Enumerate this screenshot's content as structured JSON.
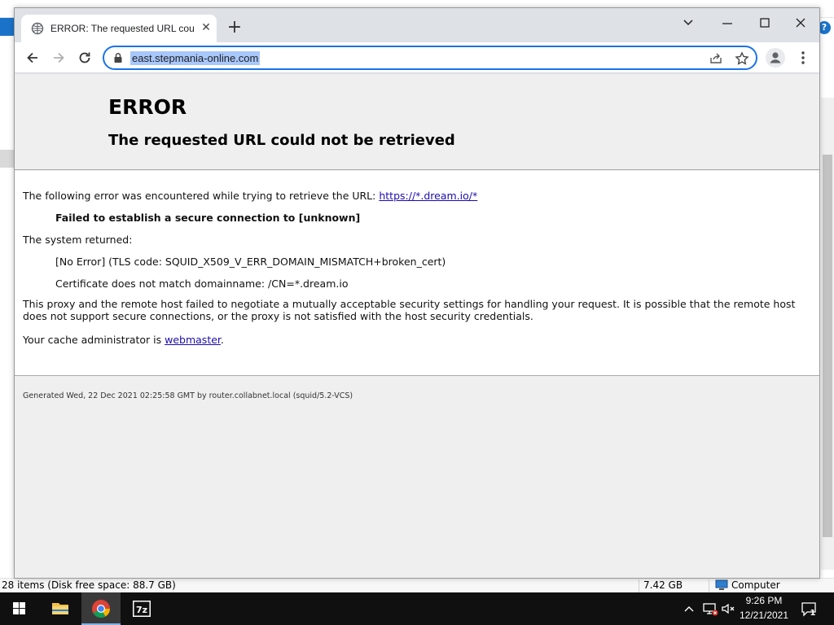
{
  "background_window": {
    "status_items": "28 items (Disk free space: 88.7 GB)",
    "status_size": "7.42 GB",
    "status_location": "Computer",
    "help_glyph": "?"
  },
  "browser": {
    "tab": {
      "title": "ERROR: The requested URL could not be retrieved",
      "close_glyph": "✕"
    },
    "new_tab_glyph": "+",
    "address": {
      "url": "east.stepmania-online.com"
    }
  },
  "page": {
    "title": "ERROR",
    "subtitle": "The requested URL could not be retrieved",
    "intro_text": "The following error was encountered while trying to retrieve the URL: ",
    "intro_link": "https://*.dream.io/*",
    "failure": "Failed to establish a secure connection to [unknown]",
    "system_returned": "The system returned:",
    "error_code": "[No Error] (TLS code: SQUID_X509_V_ERR_DOMAIN_MISMATCH+broken_cert)",
    "cert_msg": "Certificate does not match domainname: /CN=*.dream.io",
    "explanation": "This proxy and the remote host failed to negotiate a mutually acceptable security settings for handling your request. It is possible that the remote host does not support secure connections, or the proxy is not satisfied with the host security credentials.",
    "admin_prefix": "Your cache administrator is ",
    "admin_link": "webmaster",
    "admin_suffix": ".",
    "generated": "Generated Wed, 22 Dec 2021 02:25:58 GMT by router.collabnet.local (squid/5.2-VCS)"
  },
  "taskbar": {
    "time": "9:26 PM",
    "date": "12/21/2021",
    "notification_count": "1",
    "icons": [
      "windows-start-icon",
      "file-explorer-icon",
      "chrome-icon",
      "7zip-icon"
    ]
  },
  "colors": {
    "accent": "#1a73e8",
    "url_highlight": "#a8c7fa",
    "link": "#1a0dab",
    "taskbar": "#101010"
  }
}
